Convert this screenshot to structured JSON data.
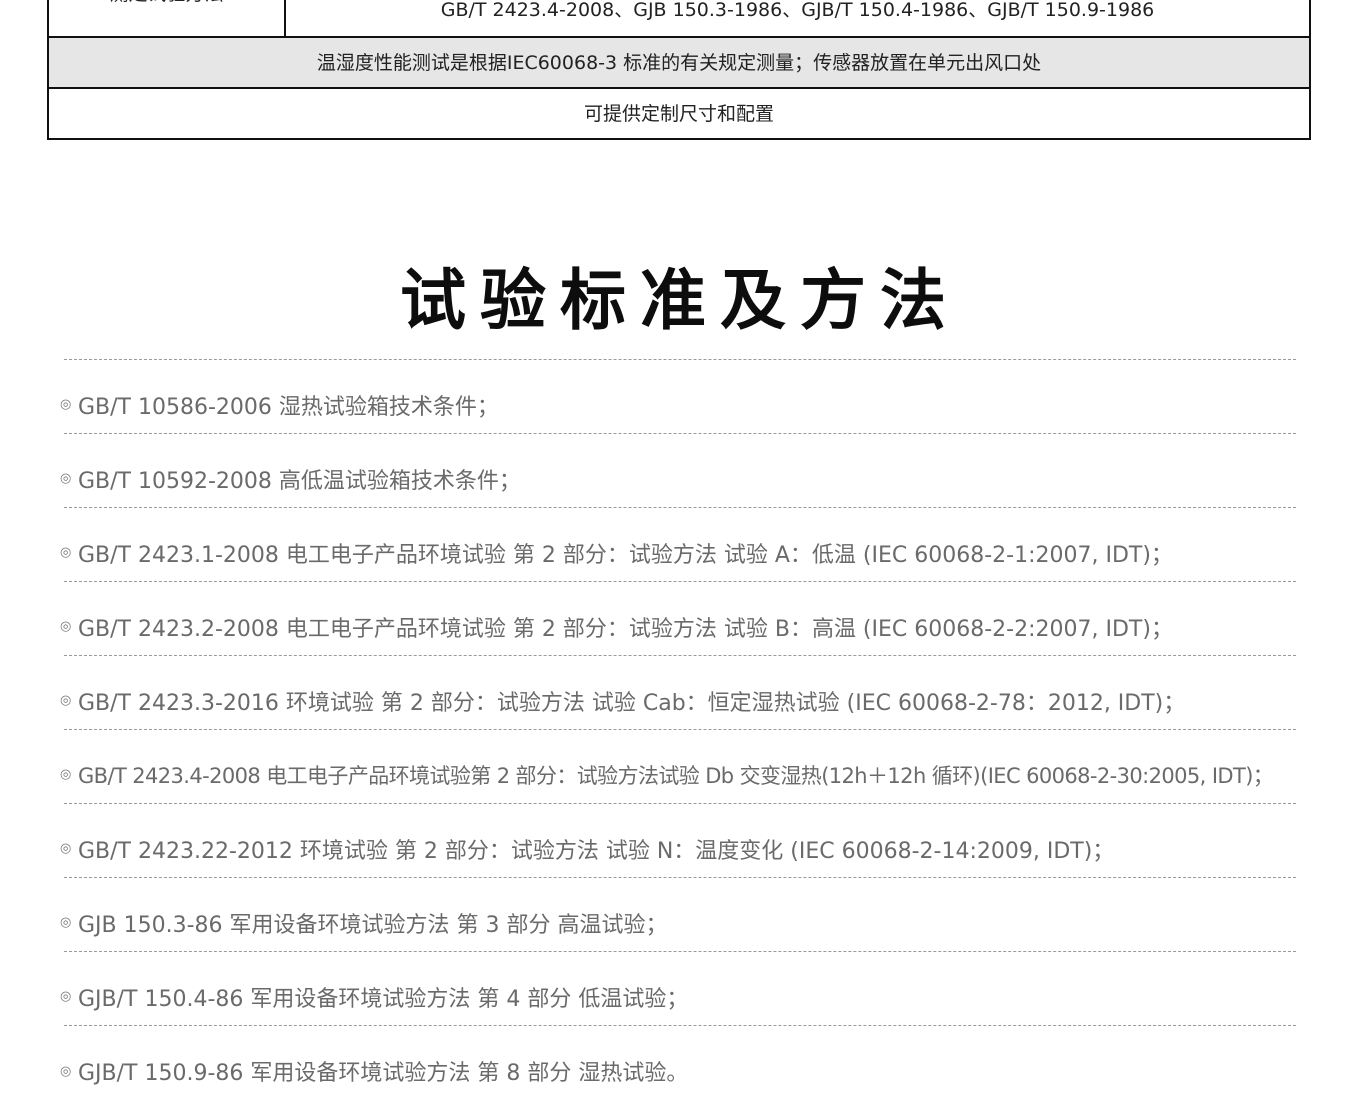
{
  "spec_table": {
    "methods_label": "测定试验方法",
    "methods_value": "GB/T 2423.4-2008、GJB 150.3-1986、GJB/T 150.4-1986、GJB/T 150.9-1986",
    "test_note": "温湿度性能测试是根据IEC60068-3 标准的有关规定测量；传感器放置在单元出风口处",
    "custom_note": "可提供定制尺寸和配置"
  },
  "section_title": "试验标准及方法",
  "bullet_symbol": "◎",
  "standards": [
    "GB/T 10586-2006 湿热试验箱技术条件；",
    "GB/T 10592-2008 高低温试验箱技术条件；",
    "GB/T 2423.1-2008 电工电子产品环境试验 第 2 部分：试验方法 试验 A：低温 (IEC 60068-2-1:2007, IDT)；",
    "GB/T 2423.2-2008 电工电子产品环境试验 第 2 部分：试验方法 试验 B：高温 (IEC 60068-2-2:2007, IDT)；",
    "GB/T 2423.3-2016 环境试验 第 2 部分：试验方法 试验 Cab：恒定湿热试验 (IEC 60068-2-78：2012, IDT)；",
    "GB/T 2423.4-2008 电工电子产品环境试验第 2 部分：试验方法试验 Db 交变湿热(12h＋12h 循环)(IEC 60068-2-30:2005, IDT)；",
    "GB/T 2423.22-2012 环境试验 第 2 部分：试验方法 试验 N：温度变化 (IEC 60068-2-14:2009, IDT)；",
    "GJB 150.3-86 军用设备环境试验方法 第 3 部分 高温试验；",
    "GJB/T 150.4-86 军用设备环境试验方法 第 4 部分 低温试验；",
    "GJB/T 150.9-86 军用设备环境试验方法 第 8 部分 湿热试验。"
  ]
}
